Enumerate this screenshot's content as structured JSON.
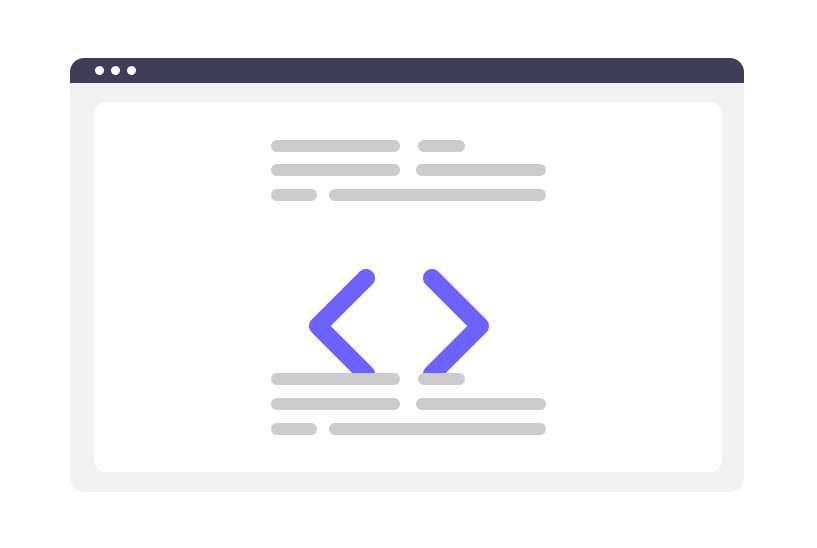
{
  "window": {
    "titlebar_color": "#3f3d56",
    "background_color": "#f2f2f2",
    "content_color": "#ffffff",
    "titlebar_dots": 3
  },
  "icon": {
    "name": "code-brackets-icon",
    "color": "#6c63ff"
  },
  "placeholder_color": "#cccccc"
}
